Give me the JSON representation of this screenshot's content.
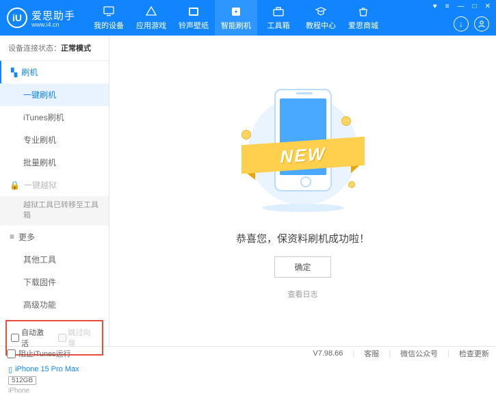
{
  "brand": {
    "name": "爱思助手",
    "url": "www.i4.cn",
    "logo_char": "iU"
  },
  "nav": [
    "我的设备",
    "应用游戏",
    "铃声壁纸",
    "智能刷机",
    "工具箱",
    "教程中心",
    "爱思商城"
  ],
  "nav_active_index": 3,
  "status": {
    "label": "设备连接状态：",
    "value": "正常模式"
  },
  "sidebar": {
    "flash_title": "刷机",
    "flash_items": [
      "一键刷机",
      "iTunes刷机",
      "专业刷机",
      "批量刷机"
    ],
    "flash_active_index": 0,
    "jailbreak_title": "一键越狱",
    "jailbreak_note": "越狱工具已转移至工具箱",
    "more_title": "更多",
    "more_items": [
      "其他工具",
      "下载固件",
      "高级功能"
    ],
    "checkbox1": "自动激活",
    "checkbox2": "跳过向导"
  },
  "device": {
    "name": "iPhone 15 Pro Max",
    "storage": "512GB",
    "type": "iPhone"
  },
  "main": {
    "ribbon": "NEW",
    "success": "恭喜您，保资料刷机成功啦！",
    "ok": "确定",
    "viewlog": "查看日志"
  },
  "footer": {
    "block_itunes": "阻止iTunes运行",
    "version": "V7.98.66",
    "links": [
      "客服",
      "微信公众号",
      "检查更新"
    ]
  }
}
